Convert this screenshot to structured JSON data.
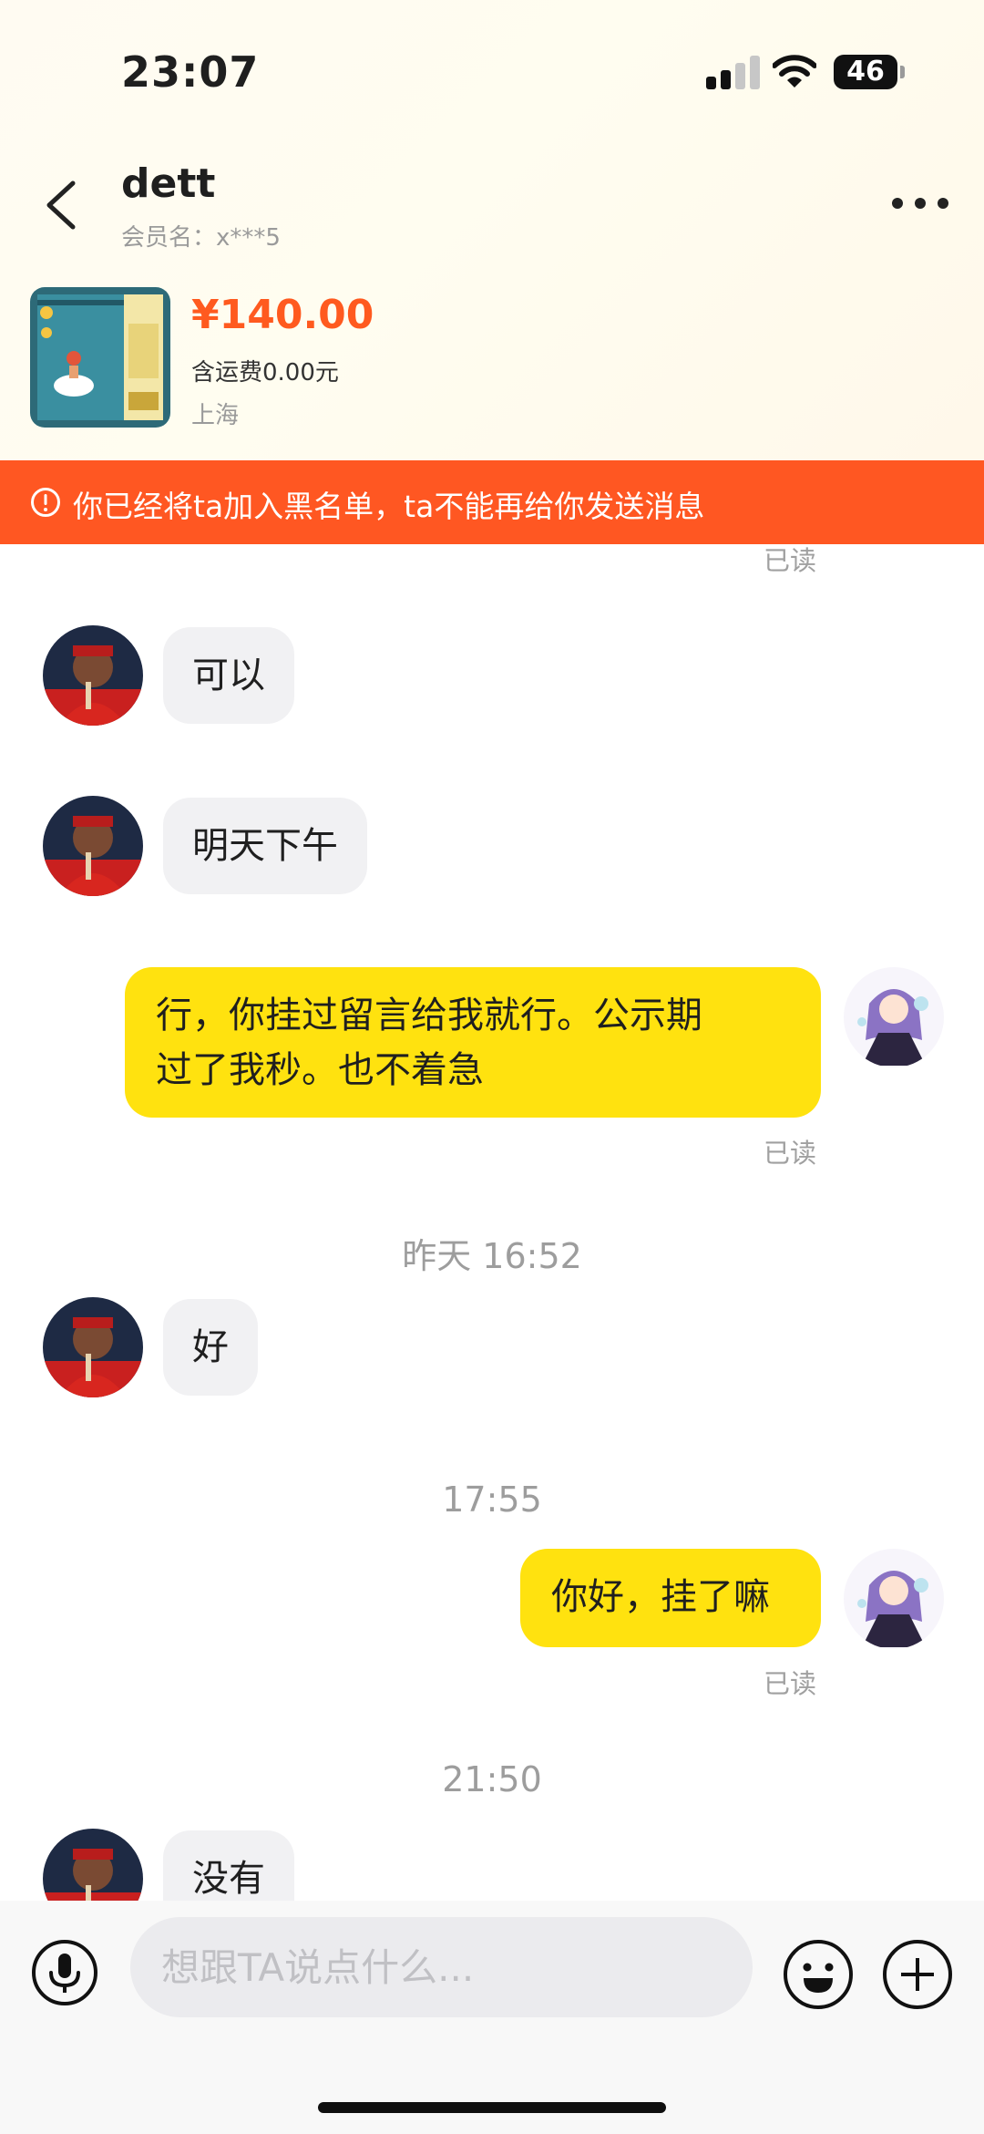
{
  "status_bar": {
    "time": "23:07",
    "battery": "46"
  },
  "header": {
    "title": "dett",
    "subtitle": "会员名：x***5"
  },
  "product": {
    "price": "¥140.00",
    "shipping": "含运费0.00元",
    "location": "上海"
  },
  "banner": {
    "text": "你已经将ta加入黑名单，ta不能再给你发送消息"
  },
  "messages": {
    "read_top": "已读",
    "m1": "可以",
    "m2": "明天下午",
    "m3_line1": "行，你挂过留言给我就行。公示期",
    "m3_line2": "过了我秒。也不着急",
    "m3_read": "已读",
    "ts1": "昨天 16:52",
    "m4": "好",
    "ts2": "17:55",
    "m5": "你好，挂了嘛",
    "m5_read": "已读",
    "ts3": "21:50",
    "m6": "没有"
  },
  "input": {
    "placeholder": "想跟TA说点什么..."
  },
  "colors": {
    "accent": "#ff5722",
    "price": "#ff5a1f",
    "outgoing_bubble": "#ffe20f",
    "incoming_bubble": "#f1f1f3"
  }
}
